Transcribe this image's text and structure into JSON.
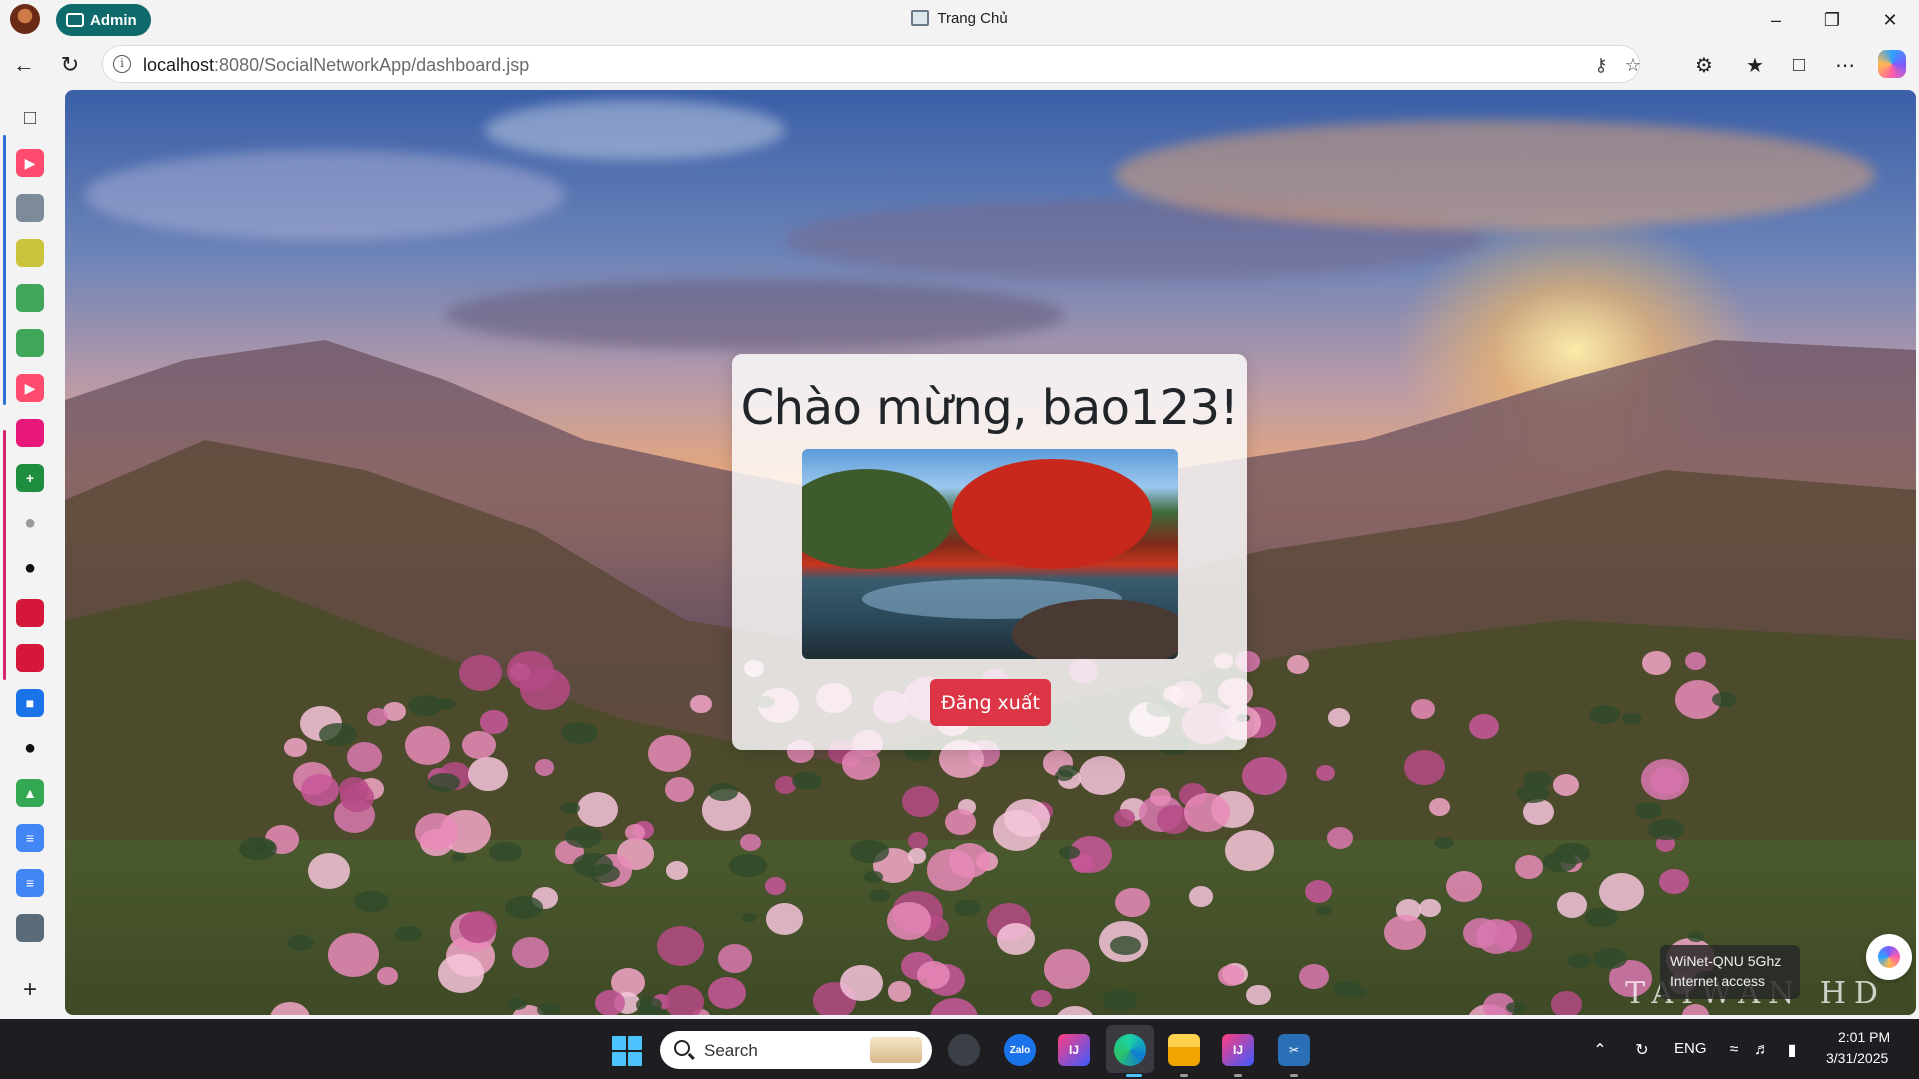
{
  "browser": {
    "profile_name": "Admin",
    "window_title": "Trang Chủ",
    "url_host": "localhost",
    "url_rest": ":8080/SocialNetworkApp/dashboard.jsp"
  },
  "page": {
    "welcome_title": "Chào mừng, bao123!",
    "logout_label": "Đăng xuất",
    "watermark": "TAIWAN HD",
    "colors": {
      "logout": "#dc3545",
      "card": "rgba(255,255,255,0.82)"
    }
  },
  "sidebar": {
    "items": [
      {
        "icon": "tab-actions-icon",
        "color": "#3b3b3b"
      },
      {
        "icon": "youtube-icon",
        "color": "#ff4b6e"
      },
      {
        "icon": "cm-app-icon",
        "color": "#7c8a99"
      },
      {
        "icon": "flag-app-icon",
        "color": "#c9c43b"
      },
      {
        "icon": "green-app-icon",
        "color": "#3fa65a"
      },
      {
        "icon": "green-app-icon",
        "color": "#3fa65a"
      },
      {
        "icon": "youtube-icon",
        "color": "#ff4b6e"
      },
      {
        "icon": "pink-app-icon",
        "color": "#e8177a"
      },
      {
        "icon": "sheets-icon",
        "color": "#1e8e3e"
      },
      {
        "icon": "github-icon",
        "color": "#9a9a9a"
      },
      {
        "icon": "github-icon",
        "color": "#111111"
      },
      {
        "icon": "office-icon",
        "color": "#d4173a"
      },
      {
        "icon": "office-icon",
        "color": "#d4173a"
      },
      {
        "icon": "contacts-icon",
        "color": "#1a73e8"
      },
      {
        "icon": "github-icon",
        "color": "#111111"
      },
      {
        "icon": "drive-icon",
        "color": "#34a853"
      },
      {
        "icon": "docs-icon",
        "color": "#4285f4"
      },
      {
        "icon": "docs-icon",
        "color": "#4285f4"
      },
      {
        "icon": "image-app-icon",
        "color": "#5a6b7a"
      }
    ]
  },
  "tray": {
    "wifi_name": "WiNet-QNU 5Ghz",
    "wifi_status": "Internet access",
    "language": "ENG",
    "time": "2:01 PM",
    "date": "3/31/2025"
  },
  "taskbar": {
    "search_label": "Search",
    "apps": [
      "start-icon",
      "search-icon",
      "widgets-icon",
      "zalo-icon",
      "intellij-icon",
      "edge-icon",
      "file-explorer-icon",
      "intellij-icon",
      "snipping-tool-icon"
    ]
  }
}
